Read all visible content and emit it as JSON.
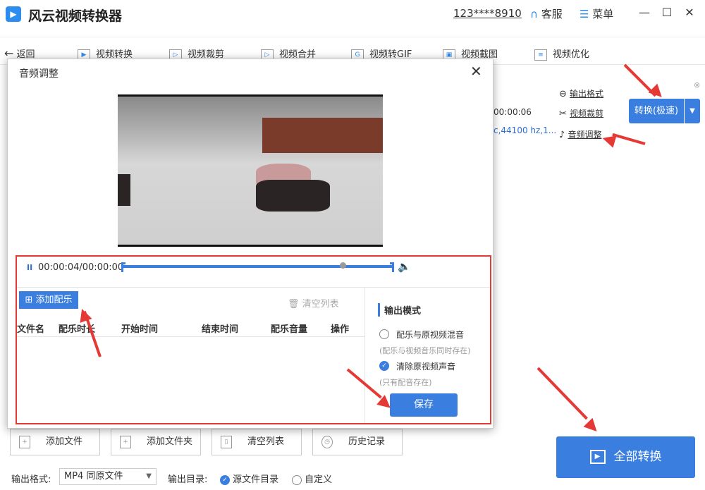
{
  "app": {
    "title": "风云视频转换器",
    "account": "123****8910",
    "service": "客服",
    "menu": "菜单"
  },
  "window": {
    "minimize": "—",
    "maximize": "☐",
    "close": "✕"
  },
  "toolbar": {
    "back": "返回",
    "items": [
      "视频转换",
      "视频裁剪",
      "视频合并",
      "视频转GIF",
      "视频截图",
      "视频优化"
    ]
  },
  "file": {
    "duration_partial": "00:00:06",
    "audio_info_partial": "c,44100 hz,1...",
    "output_format_link": "输出格式",
    "crop_link": "视频裁剪",
    "audio_link": "音频调整",
    "convert_fast": "转换(极速)"
  },
  "dialog": {
    "title": "音频调整",
    "time": "00:00:04/00:00:00",
    "add_music": "添加配乐",
    "clear_list": "清空列表",
    "columns": [
      "文件名",
      "配乐时长",
      "开始时间",
      "结束时间",
      "配乐音量",
      "操作"
    ],
    "output_mode_title": "输出模式",
    "mode1": "配乐与原视频混音",
    "mode1_hint": "(配乐与视频音乐同时存在)",
    "mode2": "清除原视频声音",
    "mode2_hint": "(只有配音存在)",
    "save": "保存"
  },
  "bottom": {
    "add_file": "添加文件",
    "add_folder": "添加文件夹",
    "clear_list": "清空列表",
    "history": "历史记录",
    "convert_all": "全部转换",
    "output_format_label": "输出格式:",
    "output_format_value": "MP4 同原文件",
    "output_dir_label": "输出目录:",
    "dir_source": "源文件目录",
    "dir_custom": "自定义"
  },
  "colors": {
    "accent": "#3a7fe0",
    "annotation": "#e53935"
  }
}
